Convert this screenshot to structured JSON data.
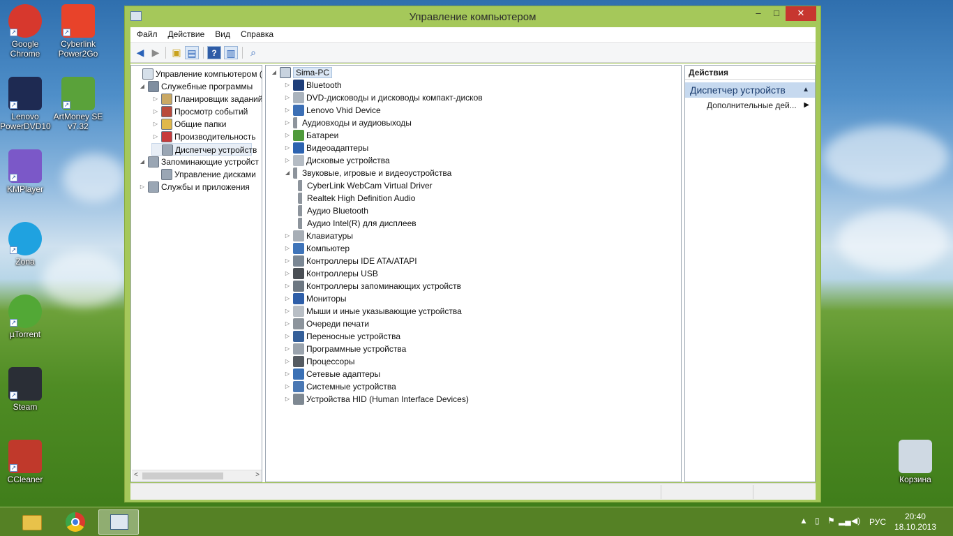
{
  "desktop": {
    "icons": [
      {
        "label_line1": "Google",
        "label_line2": "Chrome",
        "icon": "chrome-icon",
        "color": "#d7382d"
      },
      {
        "label_line1": "Cyberlink",
        "label_line2": "Power2Go",
        "icon": "power2go-icon",
        "color": "#e8432a"
      },
      {
        "label_line1": "Lenovo",
        "label_line2": "PowerDVD10",
        "icon": "powerdvd-icon",
        "color": "#1e2a52"
      },
      {
        "label_line1": "ArtMoney SE",
        "label_line2": "v7.32",
        "icon": "artmoney-icon",
        "color": "#5aa23a"
      },
      {
        "label_line1": "KMPlayer",
        "label_line2": "",
        "icon": "kmplayer-icon",
        "color": "#7b58c8"
      },
      {
        "label_line1": "Zona",
        "label_line2": "",
        "icon": "zona-icon",
        "color": "#1fa2e0"
      },
      {
        "label_line1": "µTorrent",
        "label_line2": "",
        "icon": "utorrent-icon",
        "color": "#52a836"
      },
      {
        "label_line1": "Steam",
        "label_line2": "",
        "icon": "steam-icon",
        "color": "#2a2e36"
      },
      {
        "label_line1": "CCleaner",
        "label_line2": "",
        "icon": "ccleaner-icon",
        "color": "#c0392b"
      },
      {
        "label_line1": "Корзина",
        "label_line2": "",
        "icon": "recycle-bin-icon",
        "color": "#cfd9e3"
      }
    ]
  },
  "window": {
    "title": "Управление компьютером",
    "controls": {
      "minimize": "–",
      "maximize": "□",
      "close": "✕"
    }
  },
  "menu": [
    "Файл",
    "Действие",
    "Вид",
    "Справка"
  ],
  "left_tree": [
    {
      "label": "Управление компьютером (л",
      "icon": "computer-management-icon"
    },
    {
      "label": "Служебные программы",
      "icon": "tools-icon"
    },
    {
      "label": "Планировщик заданий",
      "icon": "clock-icon"
    },
    {
      "label": "Просмотр событий",
      "icon": "event-viewer-icon"
    },
    {
      "label": "Общие папки",
      "icon": "shared-folder-icon"
    },
    {
      "label": "Производительность",
      "icon": "performance-icon"
    },
    {
      "label": "Диспетчер устройств",
      "icon": "device-manager-icon"
    },
    {
      "label": "Запоминающие устройст",
      "icon": "storage-icon"
    },
    {
      "label": "Управление дисками",
      "icon": "disk-management-icon"
    },
    {
      "label": "Службы и приложения",
      "icon": "services-icon"
    }
  ],
  "device_tree": {
    "root": "Sima-PC",
    "items": [
      {
        "label": "Bluetooth",
        "icon": "bluetooth-icon"
      },
      {
        "label": "DVD-дисководы и дисководы компакт-дисков",
        "icon": "dvd-drive-icon"
      },
      {
        "label": "Lenovo Vhid Device",
        "icon": "hid-device-icon"
      },
      {
        "label": "Аудиовходы и аудиовыходы",
        "icon": "speaker-icon"
      },
      {
        "label": "Батареи",
        "icon": "battery-icon"
      },
      {
        "label": "Видеоадаптеры",
        "icon": "display-adapter-icon"
      },
      {
        "label": "Дисковые устройства",
        "icon": "disk-drive-icon"
      },
      {
        "label": "Звуковые, игровые и видеоустройства",
        "icon": "speaker-icon"
      },
      {
        "label": "CyberLink WebCam Virtual Driver",
        "icon": "speaker-icon",
        "child": true
      },
      {
        "label": "Realtek High Definition Audio",
        "icon": "speaker-icon",
        "child": true
      },
      {
        "label": "Аудио Bluetooth",
        "icon": "speaker-icon",
        "child": true
      },
      {
        "label": "Аудио Intel(R) для дисплеев",
        "icon": "speaker-icon",
        "child": true
      },
      {
        "label": "Клавиатуры",
        "icon": "keyboard-icon"
      },
      {
        "label": "Компьютер",
        "icon": "computer-icon"
      },
      {
        "label": "Контроллеры IDE ATA/ATAPI",
        "icon": "ide-controller-icon"
      },
      {
        "label": "Контроллеры USB",
        "icon": "usb-icon"
      },
      {
        "label": "Контроллеры запоминающих устройств",
        "icon": "storage-controller-icon"
      },
      {
        "label": "Мониторы",
        "icon": "monitor-icon"
      },
      {
        "label": "Мыши и иные указывающие устройства",
        "icon": "mouse-icon"
      },
      {
        "label": "Очереди печати",
        "icon": "printer-icon"
      },
      {
        "label": "Переносные устройства",
        "icon": "portable-device-icon"
      },
      {
        "label": "Программные устройства",
        "icon": "software-device-icon"
      },
      {
        "label": "Процессоры",
        "icon": "processor-icon"
      },
      {
        "label": "Сетевые адаптеры",
        "icon": "network-adapter-icon"
      },
      {
        "label": "Системные устройства",
        "icon": "system-device-icon"
      },
      {
        "label": "Устройства HID (Human Interface Devices)",
        "icon": "hid-icon"
      }
    ]
  },
  "actions": {
    "header": "Действия",
    "section": "Диспетчер устройств",
    "more": "Дополнительные дей..."
  },
  "taskbar": {
    "language": "РУС",
    "time": "20:40",
    "date": "18.10.2013"
  }
}
